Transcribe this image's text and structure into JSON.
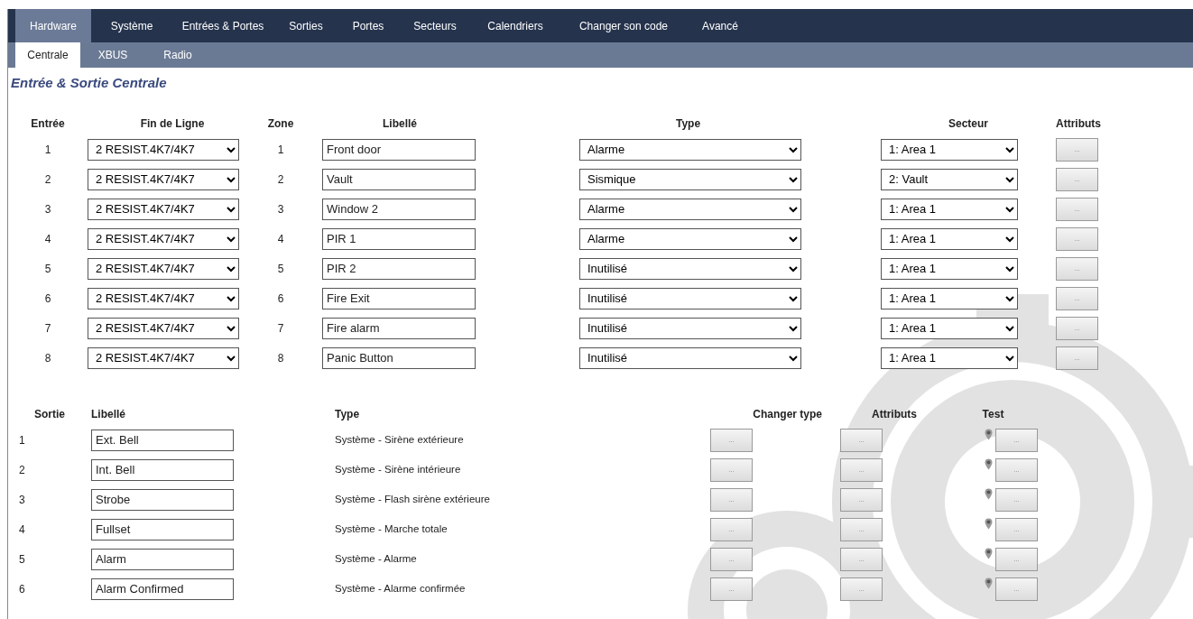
{
  "main_tabs": [
    {
      "label": "Hardware",
      "selected": true
    },
    {
      "label": "Système",
      "selected": false
    },
    {
      "label": "Entrées & Portes",
      "selected": false
    },
    {
      "label": "Sorties",
      "selected": false
    },
    {
      "label": "Portes",
      "selected": false
    },
    {
      "label": "Secteurs",
      "selected": false
    },
    {
      "label": "Calendriers",
      "selected": false
    },
    {
      "label": "Changer son code",
      "selected": false
    },
    {
      "label": "Avancé",
      "selected": false
    }
  ],
  "sub_tabs": [
    {
      "label": "Centrale",
      "selected": true
    },
    {
      "label": "XBUS",
      "selected": false
    },
    {
      "label": "Radio",
      "selected": false
    }
  ],
  "page_title": "Entrée & Sortie Centrale",
  "inputs": {
    "columns": [
      "Entrée",
      "Fin de Ligne",
      "Zone",
      "Libellé",
      "Type",
      "Secteur",
      "Attributs"
    ],
    "rows": [
      {
        "entree": "1",
        "end_of_line": "2 RESIST.4K7/4K7",
        "zone": "1",
        "label": "Front door",
        "type": "Alarme",
        "sector": "1: Area 1",
        "attributes": "..."
      },
      {
        "entree": "2",
        "end_of_line": "2 RESIST.4K7/4K7",
        "zone": "2",
        "label": "Vault",
        "type": "Sismique",
        "sector": "2: Vault",
        "attributes": "..."
      },
      {
        "entree": "3",
        "end_of_line": "2 RESIST.4K7/4K7",
        "zone": "3",
        "label": "Window 2",
        "type": "Alarme",
        "sector": "1: Area 1",
        "attributes": "..."
      },
      {
        "entree": "4",
        "end_of_line": "2 RESIST.4K7/4K7",
        "zone": "4",
        "label": "PIR 1",
        "type": "Alarme",
        "sector": "1: Area 1",
        "attributes": "..."
      },
      {
        "entree": "5",
        "end_of_line": "2 RESIST.4K7/4K7",
        "zone": "5",
        "label": "PIR 2",
        "type": "Inutilisé",
        "sector": "1: Area 1",
        "attributes": "..."
      },
      {
        "entree": "6",
        "end_of_line": "2 RESIST.4K7/4K7",
        "zone": "6",
        "label": "Fire Exit",
        "type": "Inutilisé",
        "sector": "1: Area 1",
        "attributes": "..."
      },
      {
        "entree": "7",
        "end_of_line": "2 RESIST.4K7/4K7",
        "zone": "7",
        "label": "Fire alarm",
        "type": "Inutilisé",
        "sector": "1: Area 1",
        "attributes": "..."
      },
      {
        "entree": "8",
        "end_of_line": "2 RESIST.4K7/4K7",
        "zone": "8",
        "label": "Panic Button",
        "type": "Inutilisé",
        "sector": "1: Area 1",
        "attributes": "..."
      }
    ]
  },
  "outputs": {
    "columns": [
      "Sortie",
      "Libellé",
      "Type",
      "Changer type",
      "Attributs",
      "Test"
    ],
    "rows": [
      {
        "sortie": "1",
        "label": "Ext. Bell",
        "type": "Système - Sirène extérieure",
        "change_type": "...",
        "attributes": "...",
        "test": "..."
      },
      {
        "sortie": "2",
        "label": "Int. Bell",
        "type": "Système - Sirène intérieure",
        "change_type": "...",
        "attributes": "...",
        "test": "..."
      },
      {
        "sortie": "3",
        "label": "Strobe",
        "type": "Système - Flash sirène extérieure",
        "change_type": "...",
        "attributes": "...",
        "test": "..."
      },
      {
        "sortie": "4",
        "label": "Fullset",
        "type": "Système - Marche totale",
        "change_type": "...",
        "attributes": "...",
        "test": "..."
      },
      {
        "sortie": "5",
        "label": "Alarm",
        "type": "Système - Alarme",
        "change_type": "...",
        "attributes": "...",
        "test": "..."
      },
      {
        "sortie": "6",
        "label": "Alarm Confirmed",
        "type": "Système - Alarme confirmée",
        "change_type": "...",
        "attributes": "...",
        "test": "..."
      }
    ]
  }
}
